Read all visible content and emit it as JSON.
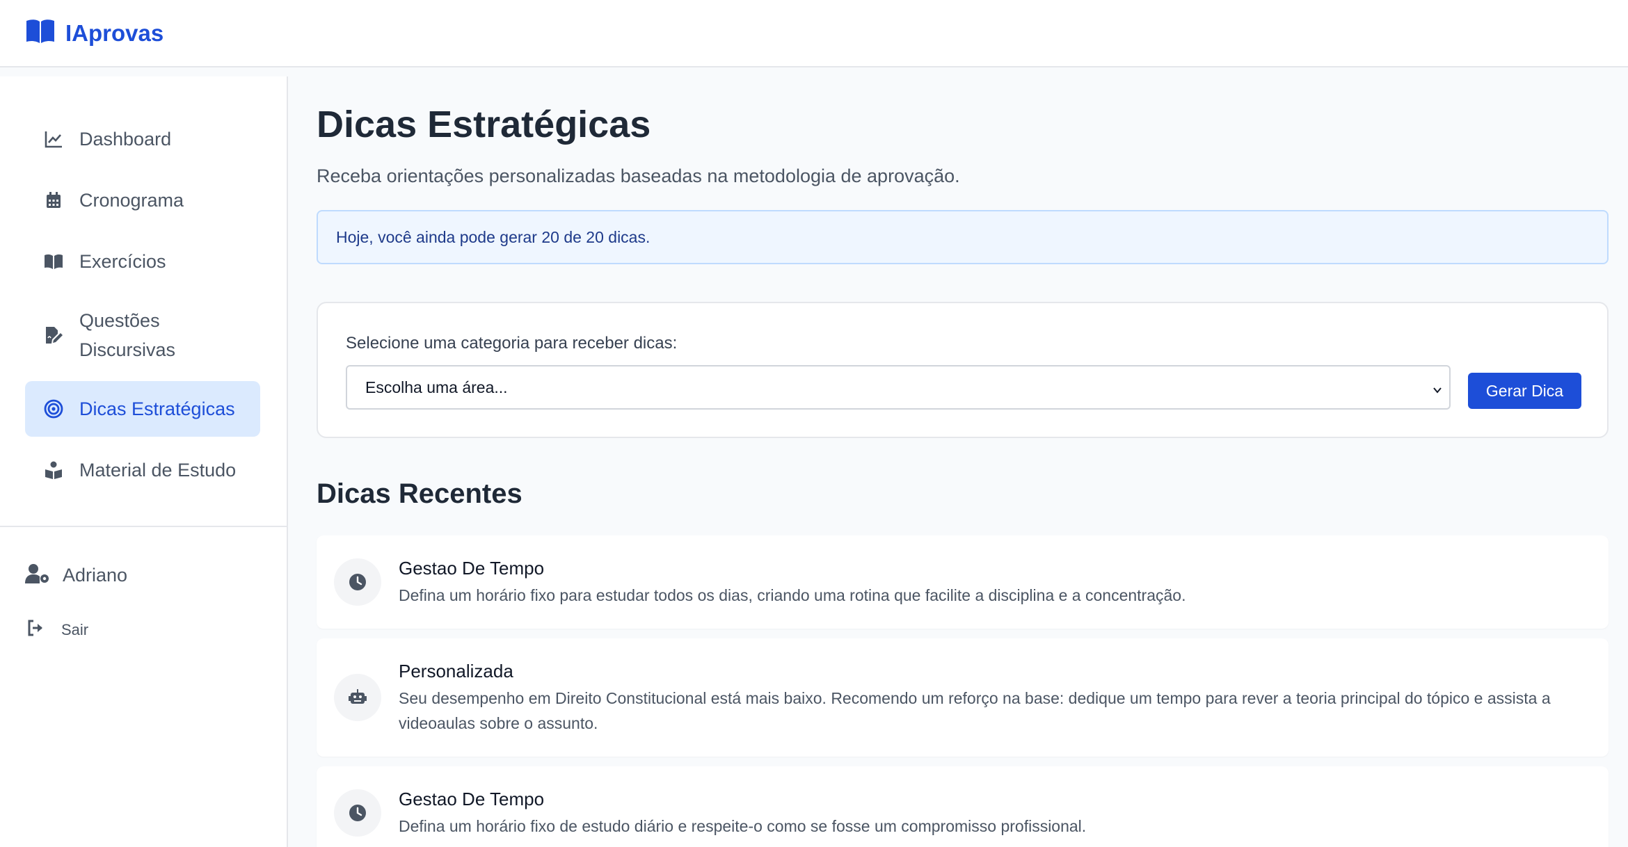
{
  "app": {
    "name": "IAprovas"
  },
  "sidebar": {
    "items": [
      {
        "label": "Dashboard",
        "icon": "chart-line-icon"
      },
      {
        "label": "Cronograma",
        "icon": "calendar-icon"
      },
      {
        "label": "Exercícios",
        "icon": "book-open-icon"
      },
      {
        "label": "Questões Discursivas",
        "icon": "file-signature-icon"
      },
      {
        "label": "Dicas Estratégicas",
        "icon": "bullseye-icon"
      },
      {
        "label": "Material de Estudo",
        "icon": "book-reader-icon"
      }
    ],
    "user": {
      "name": "Adriano"
    },
    "logout_label": "Sair"
  },
  "main": {
    "title": "Dicas Estratégicas",
    "subtitle": "Receba orientações personalizadas baseadas na metodologia de aprovação.",
    "notice": "Hoje, você ainda pode gerar 20 de 20 dicas.",
    "form": {
      "label": "Selecione uma categoria para receber dicas:",
      "select_value": "Escolha uma área...",
      "button": "Gerar Dica"
    },
    "recent_title": "Dicas Recentes",
    "tips": [
      {
        "title": "Gestao De Tempo",
        "text": "Defina um horário fixo para estudar todos os dias, criando uma rotina que facilite a disciplina e a concentração.",
        "icon": "clock-icon"
      },
      {
        "title": "Personalizada",
        "text": "Seu desempenho em Direito Constitucional está mais baixo. Recomendo um reforço na base: dedique um tempo para rever a teoria principal do tópico e assista a videoaulas sobre o assunto.",
        "icon": "robot-icon"
      },
      {
        "title": "Gestao De Tempo",
        "text": "Defina um horário fixo de estudo diário e respeite-o como se fosse um compromisso profissional.",
        "icon": "clock-icon"
      }
    ]
  },
  "colors": {
    "accent": "#1d4ed8",
    "active_bg": "#dbeafe",
    "notice_bg": "#eff6ff"
  }
}
